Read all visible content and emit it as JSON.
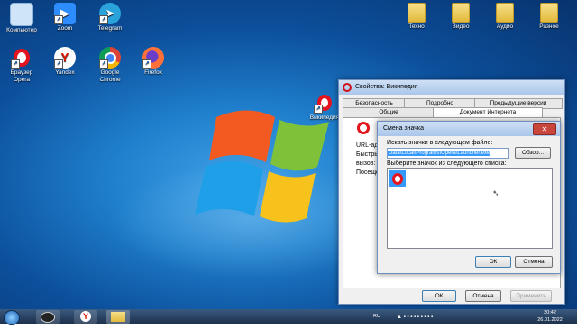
{
  "desktop_icons": [
    {
      "label": "Компьютер",
      "icon": "computer-icon",
      "color": "#5fa7e8"
    },
    {
      "label": "Zoom",
      "icon": "zoom-icon",
      "color": "#2d8cff"
    },
    {
      "label": "Telegram",
      "icon": "telegram-icon",
      "color": "#2aa3dd"
    },
    {
      "label": "Браузер Opera",
      "icon": "opera-icon",
      "color": "#e4141f"
    },
    {
      "label": "Yandex",
      "icon": "yandex-icon",
      "color": "#ffffff"
    },
    {
      "label": "Google Chrome",
      "icon": "chrome-icon",
      "color": "#e5b000"
    },
    {
      "label": "Firefox",
      "icon": "firefox-icon",
      "color": "#ff7139"
    },
    {
      "label": "Википедия",
      "icon": "opera-icon",
      "color": "#e4141f"
    }
  ],
  "folders": [
    "Техно",
    "Видео",
    "Аудио",
    "Разное"
  ],
  "properties_window": {
    "title": "Свойства: Википедия",
    "tabs_row1": [
      "Безопасность",
      "Подробно",
      "Предыдущие версии"
    ],
    "tabs_row2": [
      "Общие",
      "Документ Интернета"
    ],
    "partial_labels": [
      "URL-ад",
      "Быстры",
      "вызов:",
      "Посеще"
    ],
    "ok": "ОК",
    "cancel": "Отмена",
    "apply": "Применить"
  },
  "change_icon_dialog": {
    "title": "Смена значка",
    "search_label": "Искать значки в следующем файле:",
    "path_value": "Data\\Local\\Programs\\Opera\\Launcher.exe",
    "browse": "Обзор...",
    "list_label": "Выберите значок из следующего списка:",
    "ok": "ОК",
    "cancel": "Отмена"
  },
  "taskbar": {
    "lang": "RU",
    "time": "20:42",
    "date": "26.01.2022"
  }
}
